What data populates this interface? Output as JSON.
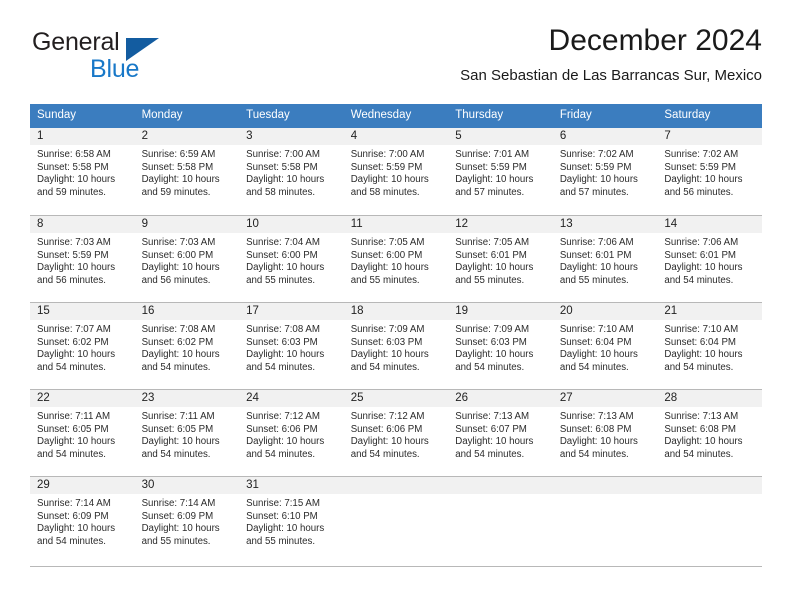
{
  "brand": {
    "name_part1": "General",
    "name_part2": "Blue",
    "logo_icon": "triangle-flag-icon",
    "color_dark": "#231f20",
    "color_blue": "#1878c8",
    "color_triangle": "#135ca0"
  },
  "header": {
    "title": "December 2024",
    "subtitle": "San Sebastian de Las Barrancas Sur, Mexico"
  },
  "theme": {
    "header_row_bg": "#3b7dbf",
    "header_row_text": "#ffffff",
    "daynum_strip_bg": "#f1f1f1",
    "grid_line": "#b8b8b8"
  },
  "weekdays": [
    "Sunday",
    "Monday",
    "Tuesday",
    "Wednesday",
    "Thursday",
    "Friday",
    "Saturday"
  ],
  "weeks": [
    [
      {
        "day": "1",
        "sunrise": "Sunrise: 6:58 AM",
        "sunset": "Sunset: 5:58 PM",
        "daylight_line1": "Daylight: 10 hours",
        "daylight_line2": "and 59 minutes."
      },
      {
        "day": "2",
        "sunrise": "Sunrise: 6:59 AM",
        "sunset": "Sunset: 5:58 PM",
        "daylight_line1": "Daylight: 10 hours",
        "daylight_line2": "and 59 minutes."
      },
      {
        "day": "3",
        "sunrise": "Sunrise: 7:00 AM",
        "sunset": "Sunset: 5:58 PM",
        "daylight_line1": "Daylight: 10 hours",
        "daylight_line2": "and 58 minutes."
      },
      {
        "day": "4",
        "sunrise": "Sunrise: 7:00 AM",
        "sunset": "Sunset: 5:59 PM",
        "daylight_line1": "Daylight: 10 hours",
        "daylight_line2": "and 58 minutes."
      },
      {
        "day": "5",
        "sunrise": "Sunrise: 7:01 AM",
        "sunset": "Sunset: 5:59 PM",
        "daylight_line1": "Daylight: 10 hours",
        "daylight_line2": "and 57 minutes."
      },
      {
        "day": "6",
        "sunrise": "Sunrise: 7:02 AM",
        "sunset": "Sunset: 5:59 PM",
        "daylight_line1": "Daylight: 10 hours",
        "daylight_line2": "and 57 minutes."
      },
      {
        "day": "7",
        "sunrise": "Sunrise: 7:02 AM",
        "sunset": "Sunset: 5:59 PM",
        "daylight_line1": "Daylight: 10 hours",
        "daylight_line2": "and 56 minutes."
      }
    ],
    [
      {
        "day": "8",
        "sunrise": "Sunrise: 7:03 AM",
        "sunset": "Sunset: 5:59 PM",
        "daylight_line1": "Daylight: 10 hours",
        "daylight_line2": "and 56 minutes."
      },
      {
        "day": "9",
        "sunrise": "Sunrise: 7:03 AM",
        "sunset": "Sunset: 6:00 PM",
        "daylight_line1": "Daylight: 10 hours",
        "daylight_line2": "and 56 minutes."
      },
      {
        "day": "10",
        "sunrise": "Sunrise: 7:04 AM",
        "sunset": "Sunset: 6:00 PM",
        "daylight_line1": "Daylight: 10 hours",
        "daylight_line2": "and 55 minutes."
      },
      {
        "day": "11",
        "sunrise": "Sunrise: 7:05 AM",
        "sunset": "Sunset: 6:00 PM",
        "daylight_line1": "Daylight: 10 hours",
        "daylight_line2": "and 55 minutes."
      },
      {
        "day": "12",
        "sunrise": "Sunrise: 7:05 AM",
        "sunset": "Sunset: 6:01 PM",
        "daylight_line1": "Daylight: 10 hours",
        "daylight_line2": "and 55 minutes."
      },
      {
        "day": "13",
        "sunrise": "Sunrise: 7:06 AM",
        "sunset": "Sunset: 6:01 PM",
        "daylight_line1": "Daylight: 10 hours",
        "daylight_line2": "and 55 minutes."
      },
      {
        "day": "14",
        "sunrise": "Sunrise: 7:06 AM",
        "sunset": "Sunset: 6:01 PM",
        "daylight_line1": "Daylight: 10 hours",
        "daylight_line2": "and 54 minutes."
      }
    ],
    [
      {
        "day": "15",
        "sunrise": "Sunrise: 7:07 AM",
        "sunset": "Sunset: 6:02 PM",
        "daylight_line1": "Daylight: 10 hours",
        "daylight_line2": "and 54 minutes."
      },
      {
        "day": "16",
        "sunrise": "Sunrise: 7:08 AM",
        "sunset": "Sunset: 6:02 PM",
        "daylight_line1": "Daylight: 10 hours",
        "daylight_line2": "and 54 minutes."
      },
      {
        "day": "17",
        "sunrise": "Sunrise: 7:08 AM",
        "sunset": "Sunset: 6:03 PM",
        "daylight_line1": "Daylight: 10 hours",
        "daylight_line2": "and 54 minutes."
      },
      {
        "day": "18",
        "sunrise": "Sunrise: 7:09 AM",
        "sunset": "Sunset: 6:03 PM",
        "daylight_line1": "Daylight: 10 hours",
        "daylight_line2": "and 54 minutes."
      },
      {
        "day": "19",
        "sunrise": "Sunrise: 7:09 AM",
        "sunset": "Sunset: 6:03 PM",
        "daylight_line1": "Daylight: 10 hours",
        "daylight_line2": "and 54 minutes."
      },
      {
        "day": "20",
        "sunrise": "Sunrise: 7:10 AM",
        "sunset": "Sunset: 6:04 PM",
        "daylight_line1": "Daylight: 10 hours",
        "daylight_line2": "and 54 minutes."
      },
      {
        "day": "21",
        "sunrise": "Sunrise: 7:10 AM",
        "sunset": "Sunset: 6:04 PM",
        "daylight_line1": "Daylight: 10 hours",
        "daylight_line2": "and 54 minutes."
      }
    ],
    [
      {
        "day": "22",
        "sunrise": "Sunrise: 7:11 AM",
        "sunset": "Sunset: 6:05 PM",
        "daylight_line1": "Daylight: 10 hours",
        "daylight_line2": "and 54 minutes."
      },
      {
        "day": "23",
        "sunrise": "Sunrise: 7:11 AM",
        "sunset": "Sunset: 6:05 PM",
        "daylight_line1": "Daylight: 10 hours",
        "daylight_line2": "and 54 minutes."
      },
      {
        "day": "24",
        "sunrise": "Sunrise: 7:12 AM",
        "sunset": "Sunset: 6:06 PM",
        "daylight_line1": "Daylight: 10 hours",
        "daylight_line2": "and 54 minutes."
      },
      {
        "day": "25",
        "sunrise": "Sunrise: 7:12 AM",
        "sunset": "Sunset: 6:06 PM",
        "daylight_line1": "Daylight: 10 hours",
        "daylight_line2": "and 54 minutes."
      },
      {
        "day": "26",
        "sunrise": "Sunrise: 7:13 AM",
        "sunset": "Sunset: 6:07 PM",
        "daylight_line1": "Daylight: 10 hours",
        "daylight_line2": "and 54 minutes."
      },
      {
        "day": "27",
        "sunrise": "Sunrise: 7:13 AM",
        "sunset": "Sunset: 6:08 PM",
        "daylight_line1": "Daylight: 10 hours",
        "daylight_line2": "and 54 minutes."
      },
      {
        "day": "28",
        "sunrise": "Sunrise: 7:13 AM",
        "sunset": "Sunset: 6:08 PM",
        "daylight_line1": "Daylight: 10 hours",
        "daylight_line2": "and 54 minutes."
      }
    ],
    [
      {
        "day": "29",
        "sunrise": "Sunrise: 7:14 AM",
        "sunset": "Sunset: 6:09 PM",
        "daylight_line1": "Daylight: 10 hours",
        "daylight_line2": "and 54 minutes."
      },
      {
        "day": "30",
        "sunrise": "Sunrise: 7:14 AM",
        "sunset": "Sunset: 6:09 PM",
        "daylight_line1": "Daylight: 10 hours",
        "daylight_line2": "and 55 minutes."
      },
      {
        "day": "31",
        "sunrise": "Sunrise: 7:15 AM",
        "sunset": "Sunset: 6:10 PM",
        "daylight_line1": "Daylight: 10 hours",
        "daylight_line2": "and 55 minutes."
      },
      {
        "day": "",
        "sunrise": "",
        "sunset": "",
        "daylight_line1": "",
        "daylight_line2": ""
      },
      {
        "day": "",
        "sunrise": "",
        "sunset": "",
        "daylight_line1": "",
        "daylight_line2": ""
      },
      {
        "day": "",
        "sunrise": "",
        "sunset": "",
        "daylight_line1": "",
        "daylight_line2": ""
      },
      {
        "day": "",
        "sunrise": "",
        "sunset": "",
        "daylight_line1": "",
        "daylight_line2": ""
      }
    ]
  ]
}
